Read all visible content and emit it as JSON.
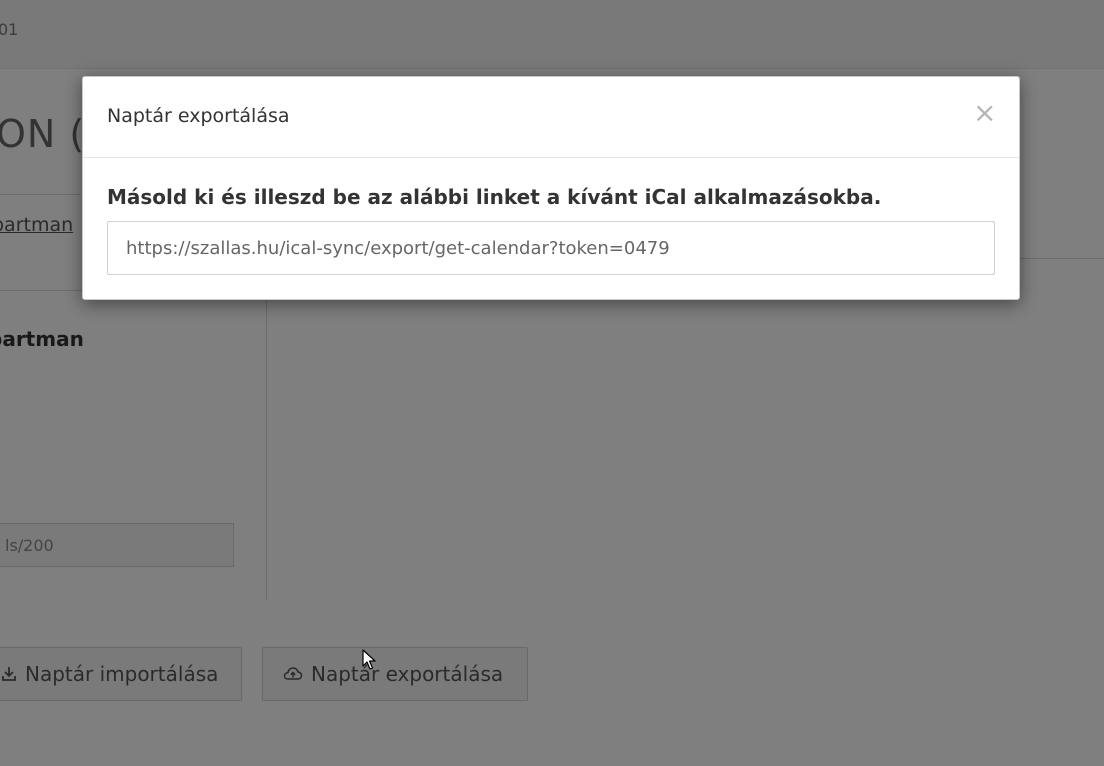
{
  "background": {
    "topbar_text": "01",
    "heading": "ON (I",
    "sublink": "partman",
    "panel": {
      "title": "partman",
      "field_value": "ls/200"
    },
    "buttons": {
      "import_label": "Naptár importálása",
      "export_label": "Naptár exportálása"
    }
  },
  "modal": {
    "title": "Naptár exportálása",
    "close_symbol": "×",
    "message": "Másold ki és illeszd be az alábbi linket a kívánt iCal alkalmazásokba.",
    "link_value": "https://szallas.hu/ical-sync/export/get-calendar?token=0479"
  },
  "icons": {
    "import": "download-icon",
    "export": "cloud-upload-icon",
    "close": "close-icon"
  },
  "colors": {
    "overlay": "#000000",
    "modal_bg": "#ffffff",
    "text_dark": "#333333"
  }
}
